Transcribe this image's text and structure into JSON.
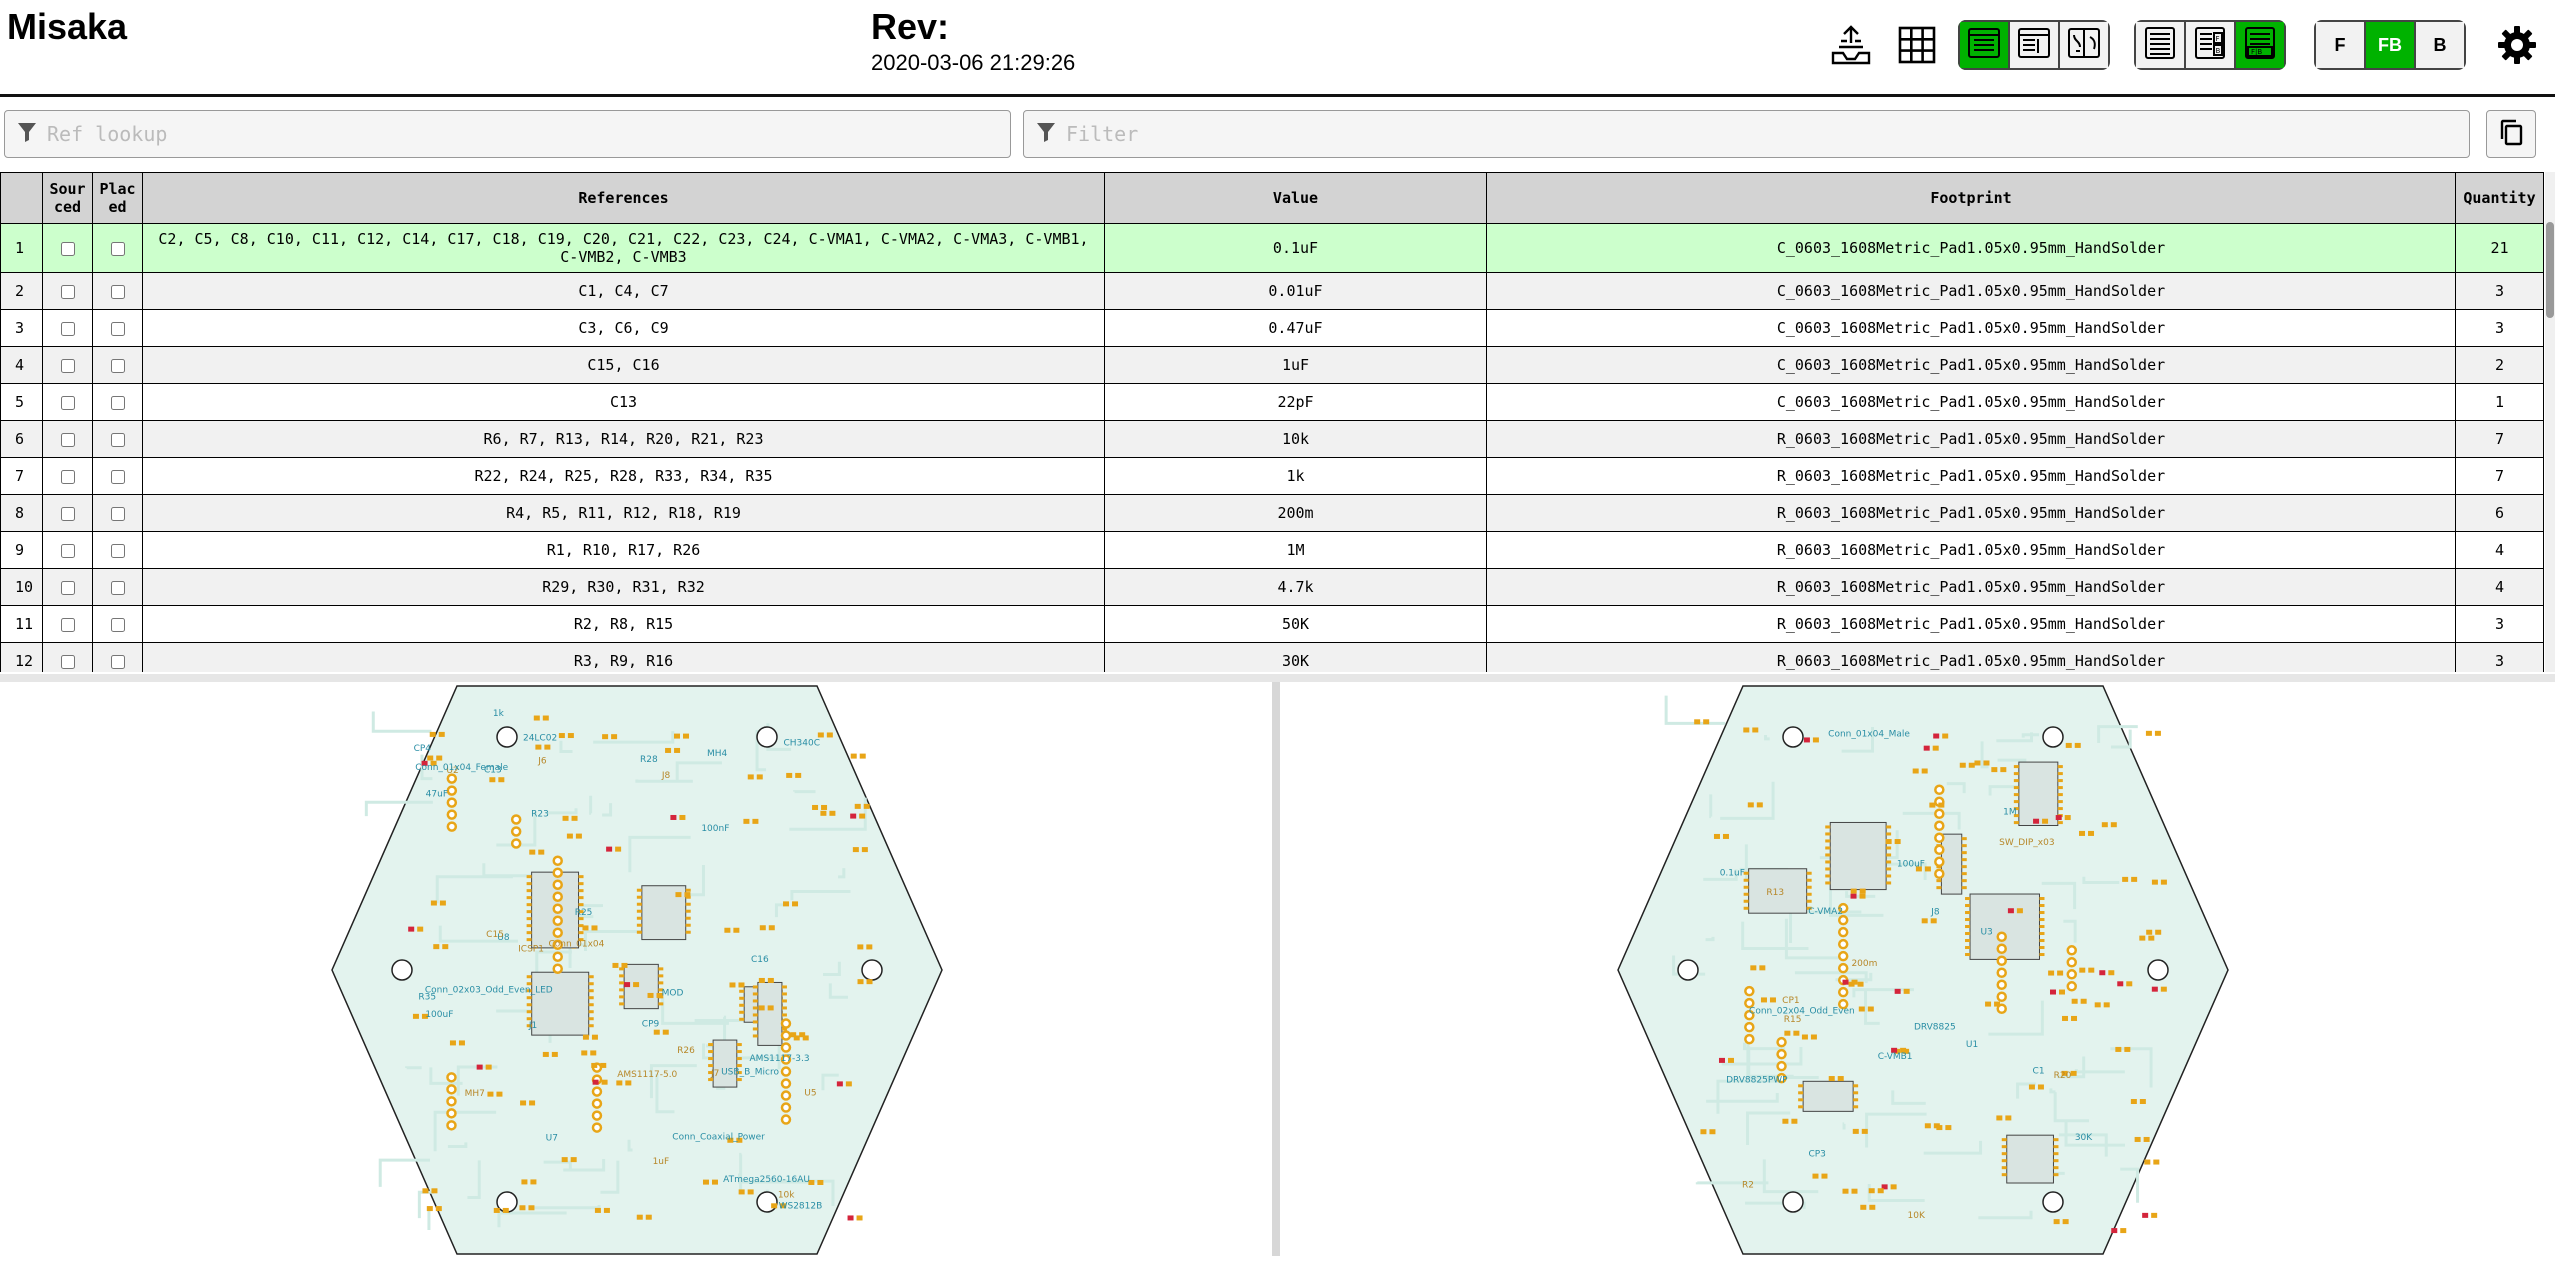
{
  "header": {
    "title": "Misaka",
    "revision_label": "Rev:",
    "revision_date": "2020-03-06 21:29:26"
  },
  "toolbar": {
    "icons": [
      "dnp-upload-icon",
      "grid-icon",
      "bom-only-icon",
      "bom-left-icon",
      "bom-top-right-icon",
      "ungrouped-list-icon",
      "grouped-fb-icon",
      "grouped-fb-active-icon",
      "settings-gear-icon"
    ],
    "layer_buttons": {
      "front": "F",
      "both": "FB",
      "back": "B"
    },
    "active_layer": "FB",
    "active_color": "#00b200"
  },
  "filters": {
    "ref_lookup_placeholder": "Ref lookup",
    "filter_placeholder": "Filter"
  },
  "table": {
    "headers": {
      "sourced": "Sourced",
      "placed": "Placed",
      "references": "References",
      "value": "Value",
      "footprint": "Footprint",
      "quantity": "Quantity"
    },
    "highlight_color": "#ccffcc",
    "rows": [
      {
        "num": "1",
        "refs": "C2, C5, C8, C10, C11, C12, C14, C17, C18, C19, C20, C21, C22, C23, C24, C-VMA1, C-VMA2, C-VMA3, C-VMB1, C-VMB2, C-VMB3",
        "value": "0.1uF",
        "footprint": "C_0603_1608Metric_Pad1.05x0.95mm_HandSolder",
        "qty": "21"
      },
      {
        "num": "2",
        "refs": "C1, C4, C7",
        "value": "0.01uF",
        "footprint": "C_0603_1608Metric_Pad1.05x0.95mm_HandSolder",
        "qty": "3"
      },
      {
        "num": "3",
        "refs": "C3, C6, C9",
        "value": "0.47uF",
        "footprint": "C_0603_1608Metric_Pad1.05x0.95mm_HandSolder",
        "qty": "3"
      },
      {
        "num": "4",
        "refs": "C15, C16",
        "value": "1uF",
        "footprint": "C_0603_1608Metric_Pad1.05x0.95mm_HandSolder",
        "qty": "2"
      },
      {
        "num": "5",
        "refs": "C13",
        "value": "22pF",
        "footprint": "C_0603_1608Metric_Pad1.05x0.95mm_HandSolder",
        "qty": "1"
      },
      {
        "num": "6",
        "refs": "R6, R7, R13, R14, R20, R21, R23",
        "value": "10k",
        "footprint": "R_0603_1608Metric_Pad1.05x0.95mm_HandSolder",
        "qty": "7"
      },
      {
        "num": "7",
        "refs": "R22, R24, R25, R28, R33, R34, R35",
        "value": "1k",
        "footprint": "R_0603_1608Metric_Pad1.05x0.95mm_HandSolder",
        "qty": "7"
      },
      {
        "num": "8",
        "refs": "R4, R5, R11, R12, R18, R19",
        "value": "200m",
        "footprint": "R_0603_1608Metric_Pad1.05x0.95mm_HandSolder",
        "qty": "6"
      },
      {
        "num": "9",
        "refs": "R1, R10, R17, R26",
        "value": "1M",
        "footprint": "R_0603_1608Metric_Pad1.05x0.95mm_HandSolder",
        "qty": "4"
      },
      {
        "num": "10",
        "refs": "R29, R30, R31, R32",
        "value": "4.7k",
        "footprint": "R_0603_1608Metric_Pad1.05x0.95mm_HandSolder",
        "qty": "4"
      },
      {
        "num": "11",
        "refs": "R2, R8, R15",
        "value": "50K",
        "footprint": "R_0603_1608Metric_Pad1.05x0.95mm_HandSolder",
        "qty": "3"
      },
      {
        "num": "12",
        "refs": "R3, R9, R16",
        "value": "30K",
        "footprint": "R_0603_1608Metric_Pad1.05x0.95mm_HandSolder",
        "qty": "3"
      }
    ]
  },
  "boards": {
    "board_fill": "#e3f3ee",
    "pad_color": "#e8a517",
    "highlight_pad_color": "#d4243b",
    "silk_color": "#2a8ea5",
    "front_labels": [
      "J7",
      "USB_B_Micro",
      "MOD",
      "U5",
      "CH340C",
      "R25",
      "J6",
      "R23",
      "C13",
      "U2",
      "U8",
      "24LC02",
      "J8",
      "Conn_01x04_Female",
      "Conn_02x03_Odd_Even_LED",
      "ICSP1",
      "R35",
      "ATmega2560-16AU",
      "Conn_01x04",
      "R28",
      "C16",
      "C15",
      "CP4",
      "CP9",
      "MH7",
      "Conn_Coaxial_Power",
      "J1",
      "AMS1117-5.0",
      "AMS1117-3.3",
      "U7",
      "R26",
      "WS2812B",
      "100uF",
      "10k",
      "1k",
      "100nF",
      "1uF",
      "47uF",
      "MH4"
    ],
    "back_labels": [
      "R13",
      "30K",
      "DRV8825PWP",
      "SW_DIP_x03",
      "U3",
      "C-VMA2",
      "R15",
      "Conn_02x04_Odd_Even",
      "J8",
      "R20",
      "DRV8825",
      "Conn_01x04_Male",
      "R2",
      "CP3",
      "C1",
      "CP1",
      "U1",
      "C-VMB1",
      "10K",
      "0.1uF",
      "100uF",
      "200m",
      "1M"
    ]
  }
}
